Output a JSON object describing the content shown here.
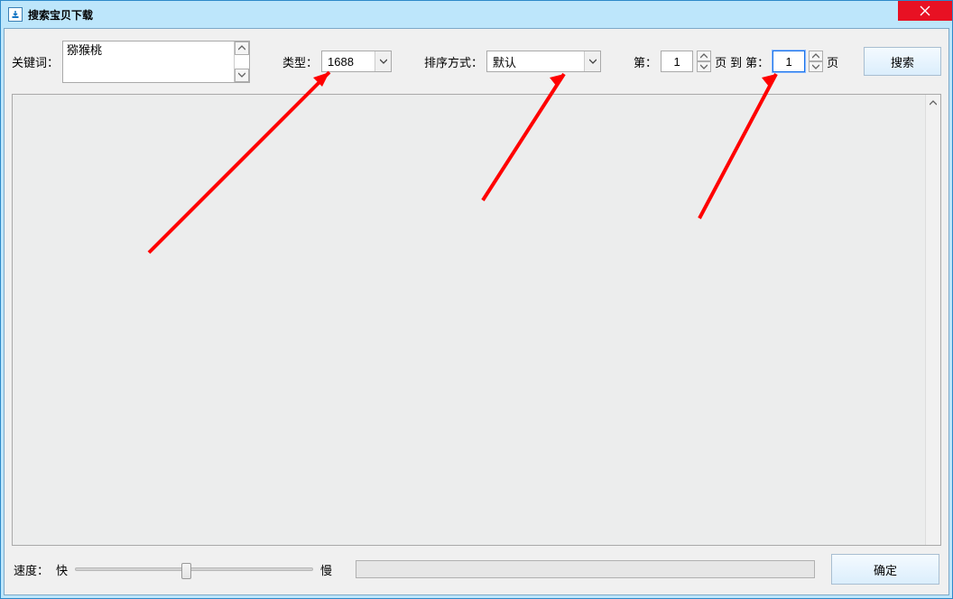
{
  "titlebar": {
    "title": "搜索宝贝下载"
  },
  "filters": {
    "keyword_label": "关键词：",
    "keyword_value": "猕猴桃",
    "type_label": "类型：",
    "type_value": "1688",
    "sort_label": "排序方式：",
    "sort_value": "默认",
    "page_from_prefix": "第：",
    "page_from_value": "1",
    "page_unit1": "页",
    "page_to_word": "到",
    "page_to_prefix": "第：",
    "page_to_value": "1",
    "page_unit2": "页",
    "search_button": "搜索"
  },
  "bottom": {
    "speed_label": "速度：",
    "speed_fast": "快",
    "speed_slow": "慢",
    "slider_percent": 47,
    "progress_percent": 0,
    "ok_button": "确定"
  },
  "icons": {
    "close": "close-icon",
    "chevron_down": "chevron-down-icon",
    "chevron_up": "chevron-up-icon"
  }
}
